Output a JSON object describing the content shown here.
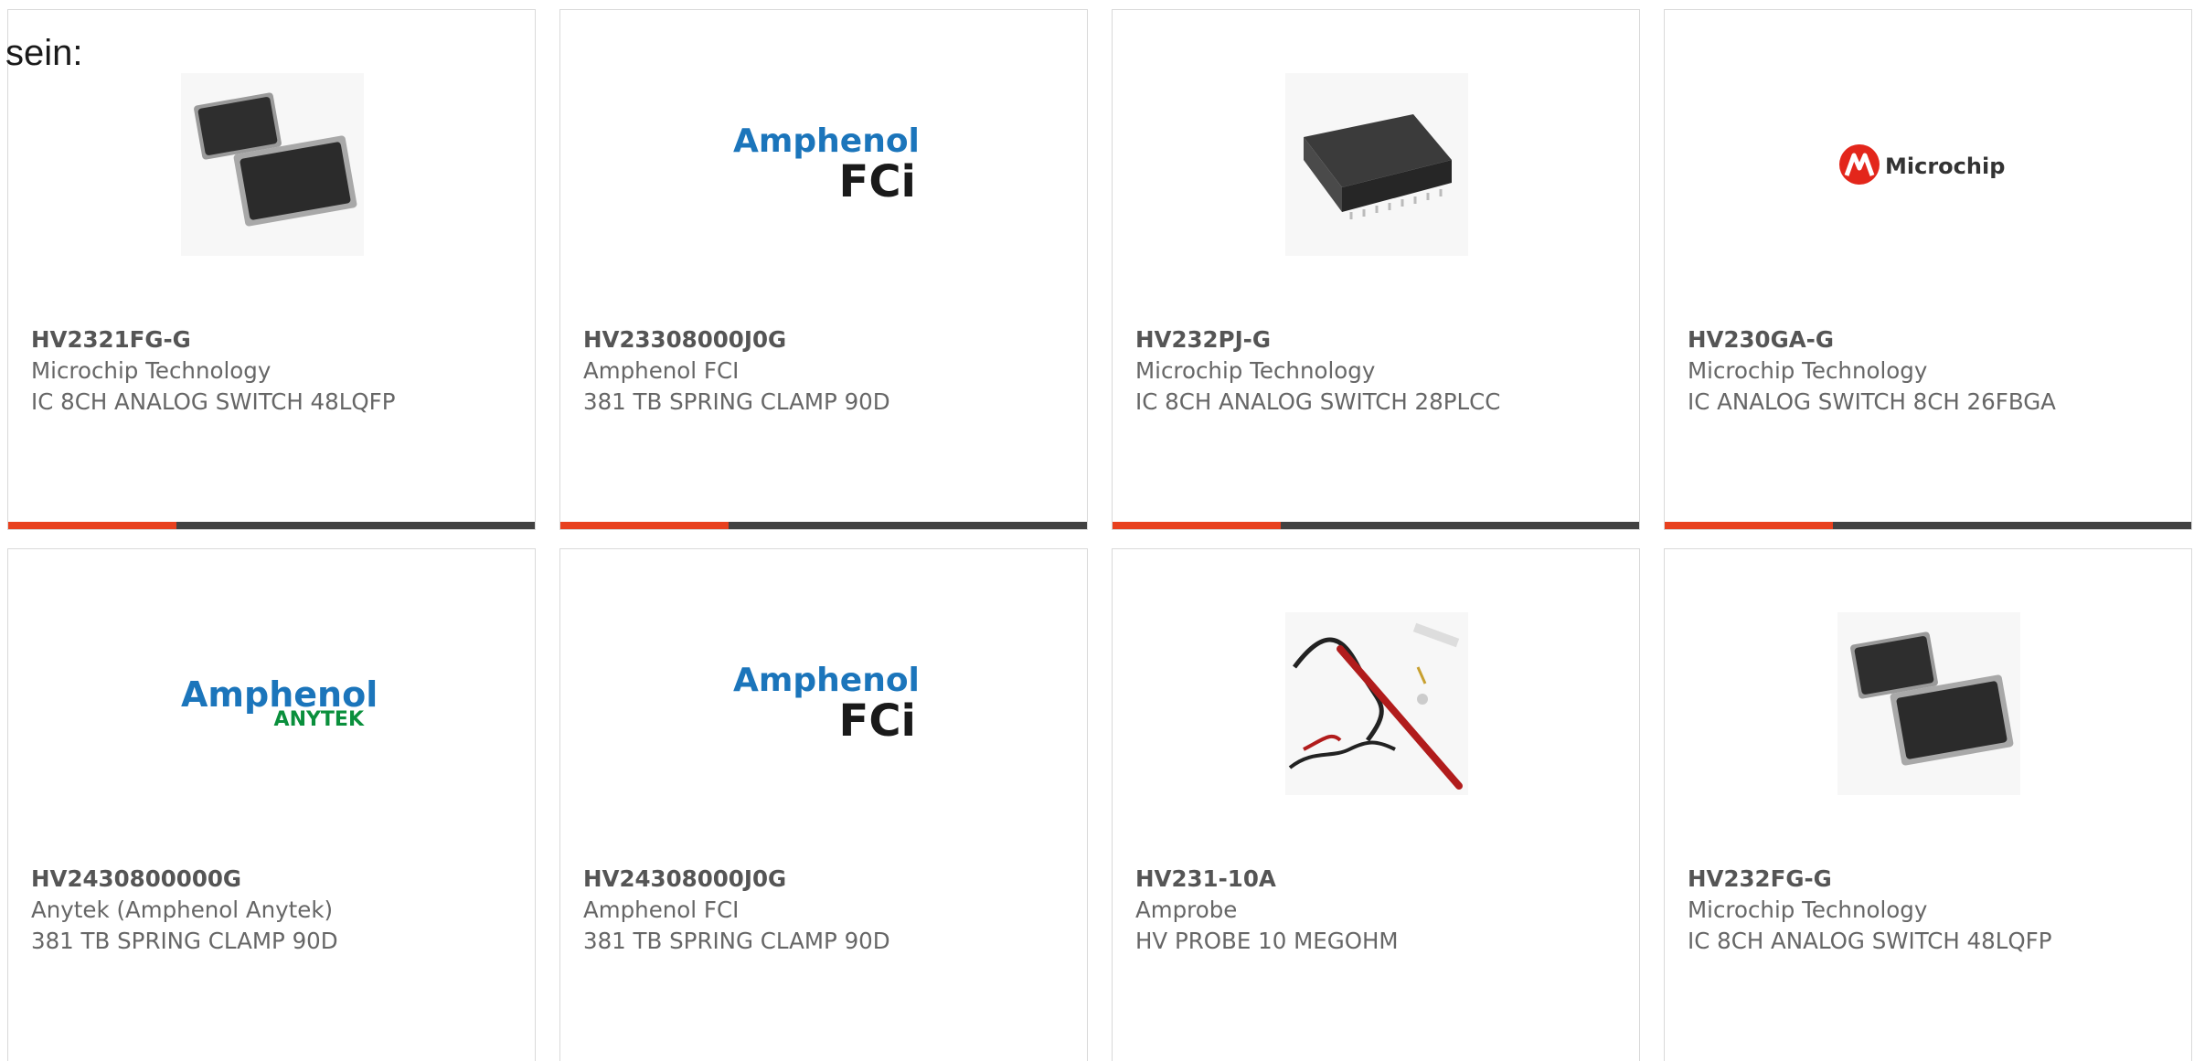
{
  "intro_text": "sein:",
  "accent_color": "#e8411f",
  "products": [
    {
      "part_number": "HV2321FG-G",
      "manufacturer": "Microchip Technology",
      "description": "IC 8CH ANALOG SWITCH 48LQFP",
      "image": "qfp-chip-pair-icon"
    },
    {
      "part_number": "HV23308000J0G",
      "manufacturer": "Amphenol FCI",
      "description": "381 TB SPRING CLAMP 90D",
      "image": "amphenol-fci-logo",
      "logo": {
        "line1": "Amphenol",
        "line2": "FCi"
      }
    },
    {
      "part_number": "HV232PJ-G",
      "manufacturer": "Microchip Technology",
      "description": "IC 8CH ANALOG SWITCH 28PLCC",
      "image": "plcc-chip-icon"
    },
    {
      "part_number": "HV230GA-G",
      "manufacturer": "Microchip Technology",
      "description": "IC ANALOG SWITCH 8CH 26FBGA",
      "image": "microchip-logo",
      "logo": {
        "text": "Microchip"
      }
    },
    {
      "part_number": "HV2430800000G",
      "manufacturer": "Anytek (Amphenol Anytek)",
      "description": "381 TB SPRING CLAMP 90D",
      "image": "amphenol-anytek-logo",
      "logo": {
        "line1": "Amphenol",
        "line2": "ANYTEK"
      }
    },
    {
      "part_number": "HV24308000J0G",
      "manufacturer": "Amphenol FCI",
      "description": "381 TB SPRING CLAMP 90D",
      "image": "amphenol-fci-logo",
      "logo": {
        "line1": "Amphenol",
        "line2": "FCi"
      }
    },
    {
      "part_number": "HV231-10A",
      "manufacturer": "Amprobe",
      "description": "HV PROBE 10 MEGOHM",
      "image": "hv-probe-icon"
    },
    {
      "part_number": "HV232FG-G",
      "manufacturer": "Microchip Technology",
      "description": "IC 8CH ANALOG SWITCH 48LQFP",
      "image": "qfp-chip-pair-icon"
    }
  ]
}
